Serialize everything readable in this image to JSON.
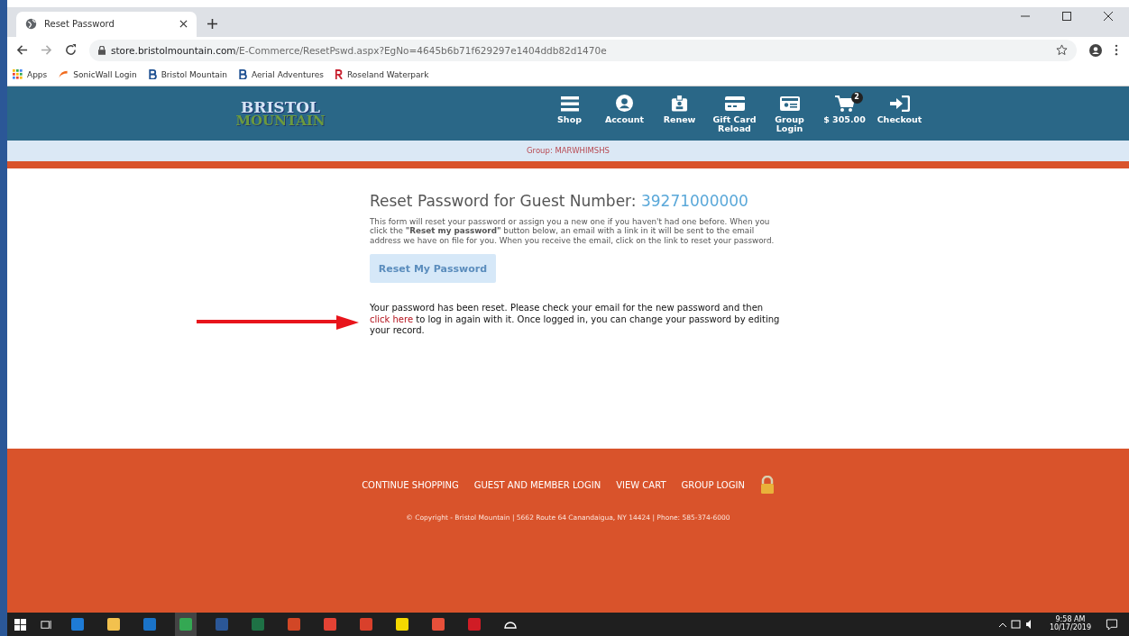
{
  "browser": {
    "tab_title": "Reset Password",
    "url_host": "store.bristolmountain.com",
    "url_path": "/E-Commerce/ResetPswd.aspx?EgNo=4645b6b71f629297e1404ddb82d1470e",
    "bookmarks": [
      {
        "label": "Apps",
        "kind": "apps"
      },
      {
        "label": "SonicWall Login",
        "kind": "sonicwall"
      },
      {
        "label": "Bristol Mountain",
        "kind": "b"
      },
      {
        "label": "Aerial Adventures",
        "kind": "b"
      },
      {
        "label": "Roseland Waterpark",
        "kind": "r"
      }
    ]
  },
  "site": {
    "logo_top": "BRISTOL",
    "logo_bottom": "MOUNTAIN",
    "nav": [
      {
        "label": "Shop",
        "kind": "menu"
      },
      {
        "label": "Account",
        "kind": "account"
      },
      {
        "label": "Renew",
        "kind": "badge"
      },
      {
        "label": "Gift Card Reload",
        "kind": "card"
      },
      {
        "label": "Group Login",
        "kind": "group"
      },
      {
        "label": "$ 305.00",
        "kind": "cart",
        "count": "2"
      },
      {
        "label": "Checkout",
        "kind": "checkout"
      }
    ],
    "group": "Group: MARWHIMSHS"
  },
  "main": {
    "title": "Reset Password for Guest Number:",
    "guest_number": "39271000000",
    "intro": "This form will reset your password or assign you a new one if you haven't had one before. When you click the **\"Reset my password\"** button below, an email with a link in it will be sent to the email address we have on file for you. When you receive the email, click on the link to reset your password.",
    "button": {
      "label": "Reset My Password",
      "disabled": true
    },
    "message_before": "Your password has been reset. Please check your email for the new password and then",
    "message_link": "click here",
    "message_after": "to log in again with it. Once logged in, you can change your password by editing your record."
  },
  "footer": {
    "links": [
      "CONTINUE SHOPPING",
      "GUEST AND MEMBER LOGIN",
      "VIEW CART",
      "GROUP LOGIN"
    ],
    "copyright": "© Copyright - Bristol Mountain | 5662 Route 64 Canandaigua, NY 14424 | Phone: 585-374-6000"
  },
  "taskbar": {
    "time": "9:58 AM",
    "date": "10/17/2019"
  }
}
